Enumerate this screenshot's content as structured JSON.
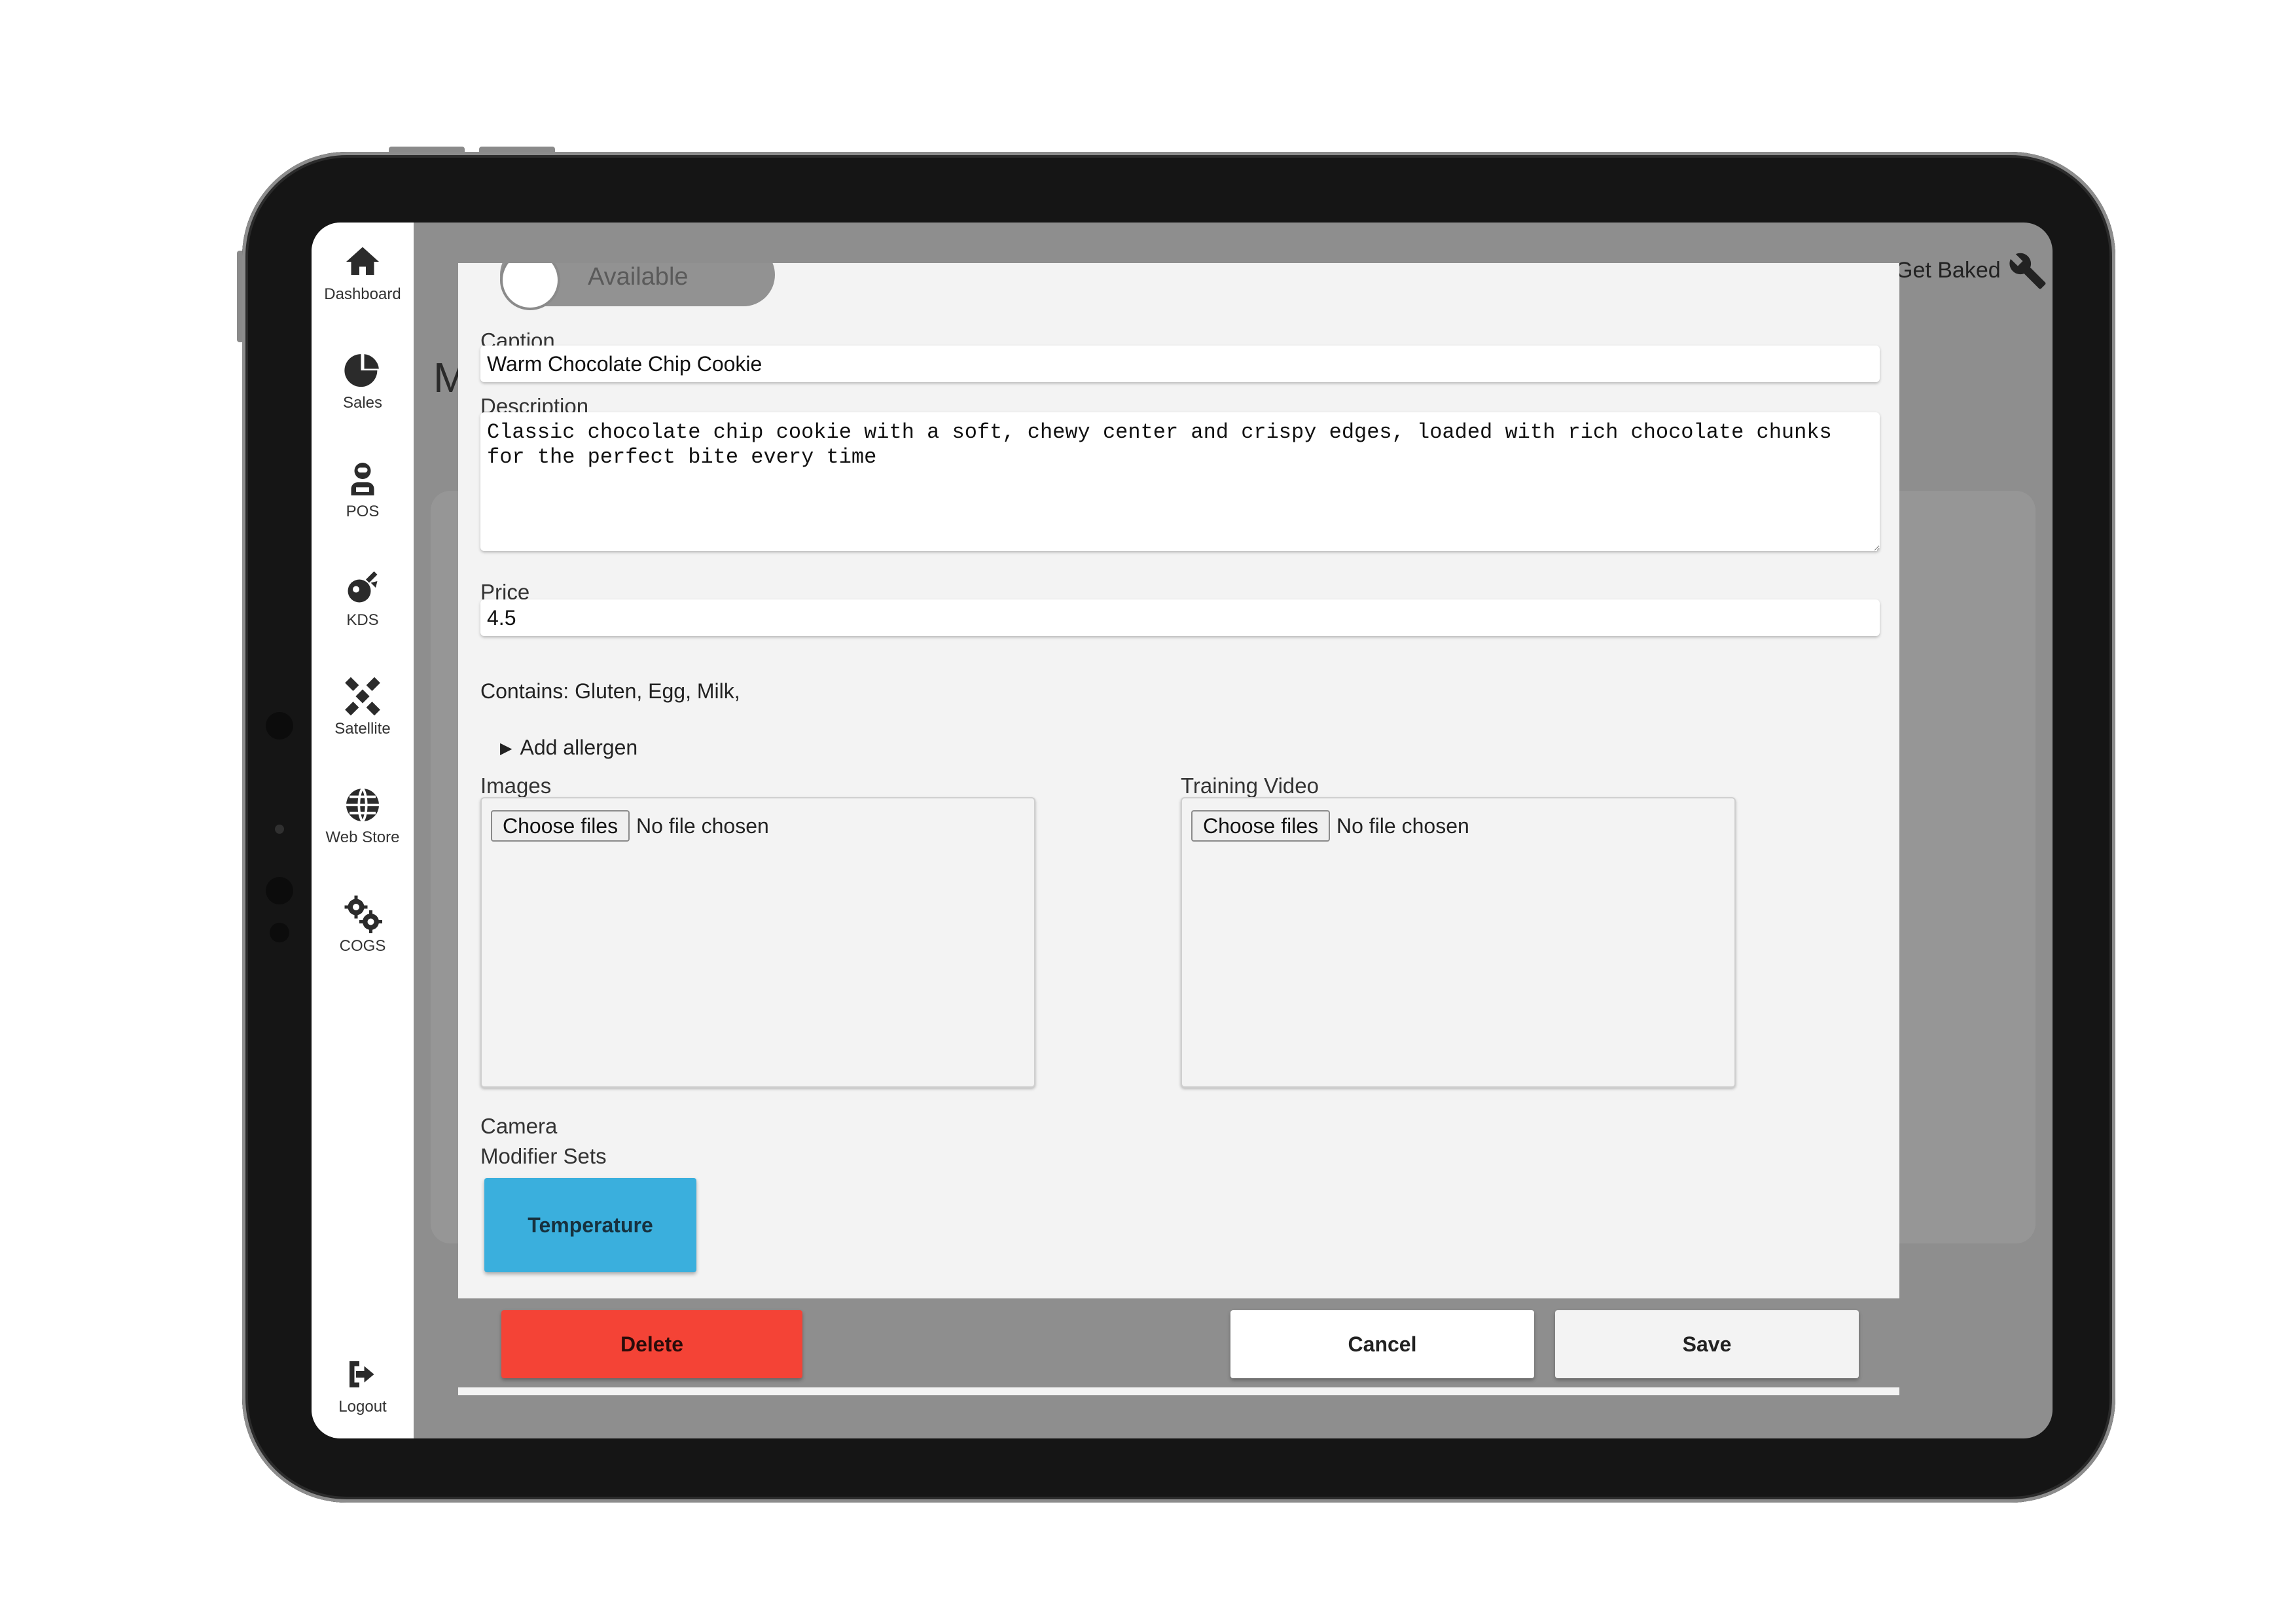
{
  "sidebar": {
    "items": [
      {
        "label": "Dashboard",
        "icon": "home-icon"
      },
      {
        "label": "Sales",
        "icon": "pie-chart-icon"
      },
      {
        "label": "POS",
        "icon": "pos-icon"
      },
      {
        "label": "KDS",
        "icon": "kds-icon"
      },
      {
        "label": "Satellite",
        "icon": "satellite-icon"
      },
      {
        "label": "Web Store",
        "icon": "globe-icon"
      },
      {
        "label": "COGS",
        "icon": "gears-icon"
      }
    ],
    "logout": {
      "label": "Logout",
      "icon": "logout-icon"
    }
  },
  "header": {
    "brand": "Get Baked",
    "brand_icon": "wrench-icon",
    "page_title_partial": "M"
  },
  "modal": {
    "toggle": {
      "label": "Available"
    },
    "caption": {
      "label": "Caption",
      "value": "Warm Chocolate Chip Cookie"
    },
    "description": {
      "label": "Description",
      "value": "Classic chocolate chip cookie with a soft, chewy center and crispy edges, loaded with rich chocolate chunks for the perfect bite every time"
    },
    "price": {
      "label": "Price",
      "value": "4.5"
    },
    "contains": "Contains: Gluten, Egg, Milk,",
    "add_allergen": "Add allergen",
    "images": {
      "label": "Images",
      "button": "Choose files",
      "status": "No file chosen"
    },
    "training_video": {
      "label": "Training Video",
      "button": "Choose files",
      "status": "No file chosen"
    },
    "camera": {
      "label": "Camera"
    },
    "modifier_sets": {
      "label": "Modifier Sets",
      "items": [
        "Temperature"
      ]
    },
    "actions": {
      "delete": "Delete",
      "cancel": "Cancel",
      "save": "Save"
    }
  },
  "colors": {
    "delete": "#f44336",
    "modifier": "#3aafdd",
    "overlay": "#8e8e8e",
    "modal_bg": "#f3f3f3"
  }
}
